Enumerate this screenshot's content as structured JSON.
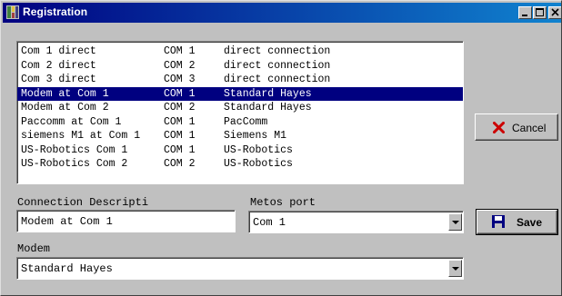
{
  "window": {
    "title": "Registration",
    "icon": "app-icon"
  },
  "titlebar_buttons": [
    "minimize-icon",
    "maximize-icon",
    "close-icon"
  ],
  "connections": {
    "selected_index": 3,
    "rows": [
      {
        "name": "Com 1 direct",
        "port": "COM 1",
        "modem": "direct connection"
      },
      {
        "name": "Com 2 direct",
        "port": "COM 2",
        "modem": "direct connection"
      },
      {
        "name": "Com 3 direct",
        "port": "COM 3",
        "modem": "direct connection"
      },
      {
        "name": "Modem at Com 1",
        "port": "COM 1",
        "modem": "Standard Hayes"
      },
      {
        "name": "Modem at Com 2",
        "port": "COM 2",
        "modem": "Standard Hayes"
      },
      {
        "name": "Paccomm at Com 1",
        "port": "COM 1",
        "modem": "PacComm"
      },
      {
        "name": "siemens M1 at Com 1",
        "port": "COM 1",
        "modem": "Siemens M1"
      },
      {
        "name": "US-Robotics Com 1",
        "port": "COM 1",
        "modem": "US-Robotics"
      },
      {
        "name": "US-Robotics Com 2",
        "port": "COM 2",
        "modem": "US-Robotics"
      }
    ]
  },
  "form": {
    "description_label": "Connection Descripti",
    "description_value": "Modem at Com 1",
    "port_label": "Metos port",
    "port_value": "Com 1",
    "modem_label": "Modem",
    "modem_value": "Standard Hayes"
  },
  "buttons": {
    "cancel": {
      "label": "Cancel",
      "icon": "x-icon",
      "icon_color": "#cc0000"
    },
    "save": {
      "label": "Save",
      "icon": "floppy-disk-icon",
      "icon_color": "#000080"
    }
  },
  "colors": {
    "title_bar": "#000080",
    "selection": "#000080",
    "face": "#c0c0c0"
  }
}
